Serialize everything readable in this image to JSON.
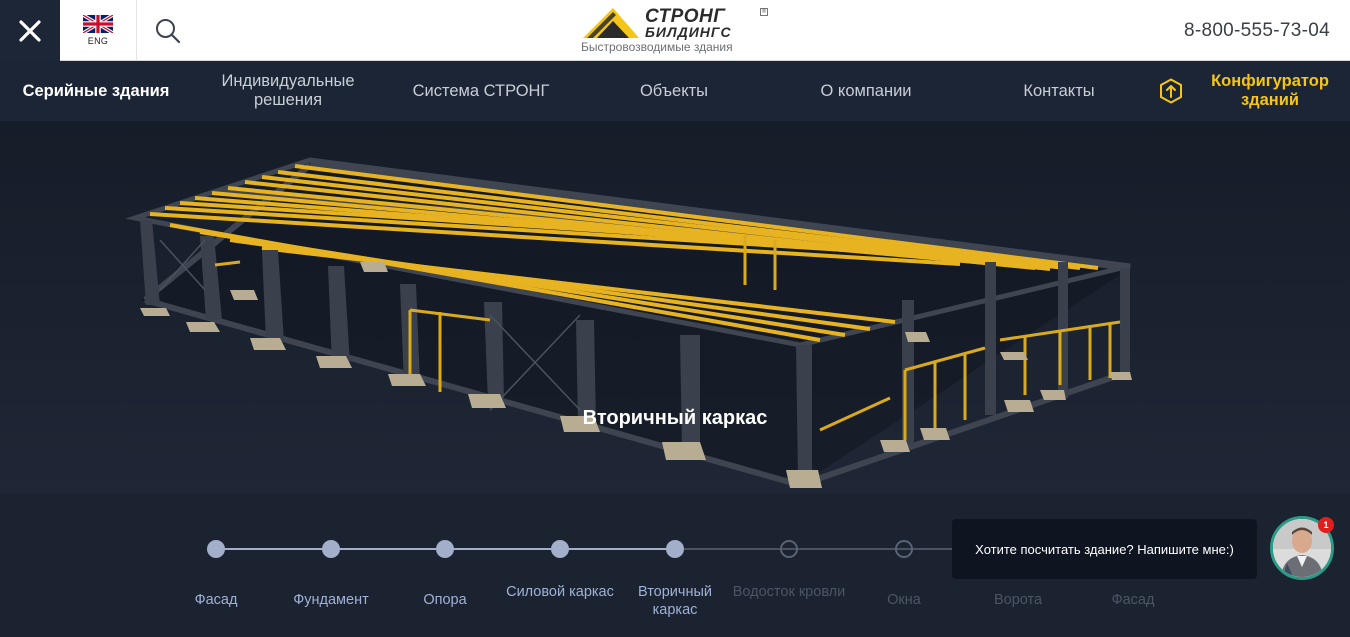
{
  "header": {
    "close_icon": "close-icon",
    "language": {
      "code": "ENG",
      "flag_icon": "uk-flag-icon"
    },
    "search_icon": "search-icon",
    "logo": {
      "line1": "СТРОНГ",
      "line2": "БИЛДИНГС",
      "tagline": "Быстровозводимые здания"
    },
    "phone": "8-800-555-73-04"
  },
  "nav": {
    "items": [
      {
        "label": "Серийные здания",
        "active": true
      },
      {
        "label": "Индивидуальные решения"
      },
      {
        "label": "Система СТРОНГ"
      },
      {
        "label": "Объекты"
      },
      {
        "label": "О компании"
      },
      {
        "label": "Контакты"
      }
    ],
    "configurator": {
      "label": "Конфигуратор зданий",
      "icon": "configurator-icon"
    }
  },
  "hero": {
    "caption": "Вторичный каркас"
  },
  "steps": [
    {
      "label": "Фасад",
      "done": true
    },
    {
      "label": "Фундамент",
      "done": true
    },
    {
      "label": "Опора",
      "done": true
    },
    {
      "label": "Силовой каркас",
      "done": true
    },
    {
      "label": "Вторичный каркас",
      "done": true
    },
    {
      "label": "Водосток кровли",
      "done": false
    },
    {
      "label": "Окна",
      "done": false
    },
    {
      "label": "Ворота",
      "done": false
    },
    {
      "label": "Фасад",
      "done": false
    }
  ],
  "chat": {
    "message": "Хотите посчитать здание? Напишите мне:)",
    "badge": "1"
  },
  "colors": {
    "accent": "#f5c518",
    "nav_bg": "#1c2535",
    "step_done": "#a3afca",
    "step_todo": "#5a6373",
    "chat_ring": "#2b9a86",
    "badge": "#e21d1d"
  }
}
